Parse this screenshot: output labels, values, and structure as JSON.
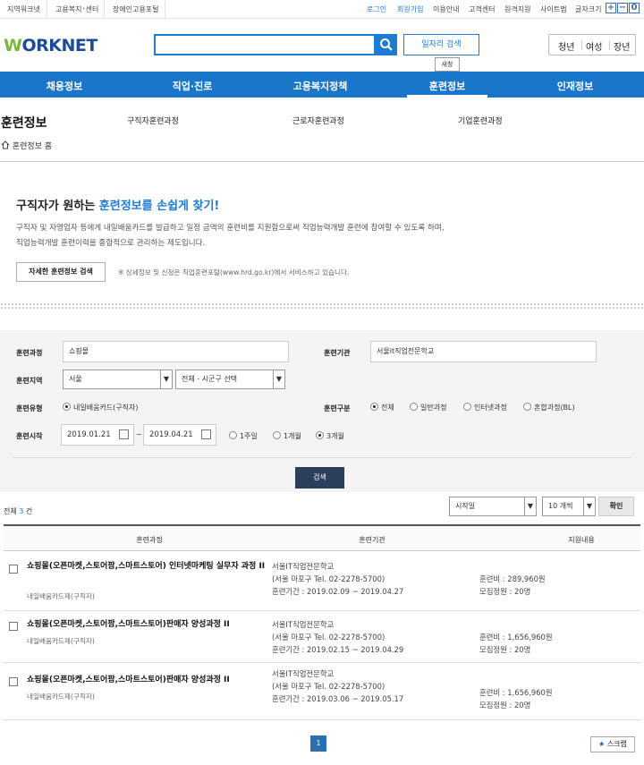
{
  "top_links_left": [
    "지역워크넷",
    "고용복지⁺센터",
    "장애인고용포털"
  ],
  "top_links_right": [
    "로그인",
    "회원가입",
    "이용안내",
    "고객센터",
    "원격지원",
    "사이트맵",
    "글자크기"
  ],
  "font_buttons": [
    "+",
    "−",
    "0"
  ],
  "logo": {
    "w": "W",
    "rest": "ORKNET"
  },
  "header": {
    "job_search_label": "일자리 검색",
    "tooltip": "새창",
    "age_tabs": [
      "청년",
      "여성",
      "장년"
    ]
  },
  "gnb": [
    "채용정보",
    "직업·진로",
    "고용복지정책",
    "훈련정보",
    "인재정보"
  ],
  "sub": {
    "title": "훈련정보",
    "menu": [
      "구직자훈련과정",
      "근로자훈련과정",
      "기업훈련과정"
    ],
    "home": "훈련정보 홈"
  },
  "intro": {
    "title_pre": "구직자가 원하는 ",
    "title_hl": "훈련정보를 손쉽게 찾기!",
    "line1": "구직자 및 자영업자 등에게 내일배움카드를 발급하고 일정 금액의 훈련비를 지원함으로써 직업능력개발 훈련에 참여할 수 있도록 하며,",
    "line2": "직업능력개발 훈련이력을 종합적으로 관리하는 제도입니다.",
    "detail_button": "자세한 훈련정보 검색",
    "note": "※ 상세정보 및 신청은 직업훈련포털(www.hrd.go.kr)에서 서비스하고 있습니다."
  },
  "form": {
    "course_label": "훈련과정",
    "course_value": "쇼핑몰",
    "org_label": "훈련기관",
    "org_value": "서울it직업전문학교",
    "region_label": "훈련지역",
    "region_value": "서울",
    "district_value": "전체 - 시군구 선택",
    "type_label": "훈련유형",
    "type_option": "내일배움카드(구직자)",
    "category_label": "훈련구분",
    "category_options": [
      "전체",
      "일반과정",
      "인터넷과정",
      "혼합과정(BL)"
    ],
    "start_label": "훈련시작",
    "date_from": "2019.01.21",
    "tilde": "~",
    "date_to": "2019.04.21",
    "period_options": [
      "1주일",
      "1개월",
      "3개월"
    ],
    "search_button": "검색"
  },
  "results": {
    "total_pre": "전체 ",
    "total_count": "3",
    "total_post": " 건",
    "sort_value": "시작일",
    "size_value": "10 개씩",
    "confirm": "확인",
    "headers": [
      "훈련과정",
      "훈련기관",
      "지원내용"
    ],
    "rows": [
      {
        "title": "쇼핑몰(오픈마켓,스토어팜,스마트스토어) 인터넷마케팅 실무자 과정 II",
        "type": "내일배움카드제(구직자)",
        "org": "서울IT직업전문학교",
        "addr": "(서울 마포구 Tel. 02-2278-5700)",
        "period": "훈련기간 : 2019.02.09 ~ 2019.04.27",
        "fee": "훈련비 : 289,960원",
        "quota": "모집정원 : 20명"
      },
      {
        "title": "쇼핑몰(오픈마켓,스토어팜,스마트스토어)판매자 양성과정 II",
        "type": "내일배움카드제(구직자)",
        "org": "서울IT직업전문학교",
        "addr": "(서울 마포구 Tel. 02-2278-5700)",
        "period": "훈련기간 : 2019.02.15 ~ 2019.04.29",
        "fee": "훈련비 : 1,656,960원",
        "quota": "모집정원 : 20명"
      },
      {
        "title": "쇼핑몰(오픈마켓,스토어팜,스마트스토어)판매자 양성과정 II",
        "type": "내일배움카드제(구직자)",
        "org": "서울IT직업전문학교",
        "addr": "(서울 마포구 Tel. 02-2278-5700)",
        "period": "훈련기간 : 2019.03.06 ~ 2019.05.17",
        "fee": "훈련비 : 1,656,960원",
        "quota": "모집정원 : 20명"
      }
    ],
    "page": "1",
    "scrap": "스크랩"
  },
  "colors": {
    "brand_blue": "#1976c8",
    "logo_green": "#7cb342",
    "button_dark": "#2b3e5c"
  },
  "icons": [
    "search-icon",
    "home-icon",
    "calendar-icon",
    "chevron-down-icon",
    "star-icon"
  ]
}
